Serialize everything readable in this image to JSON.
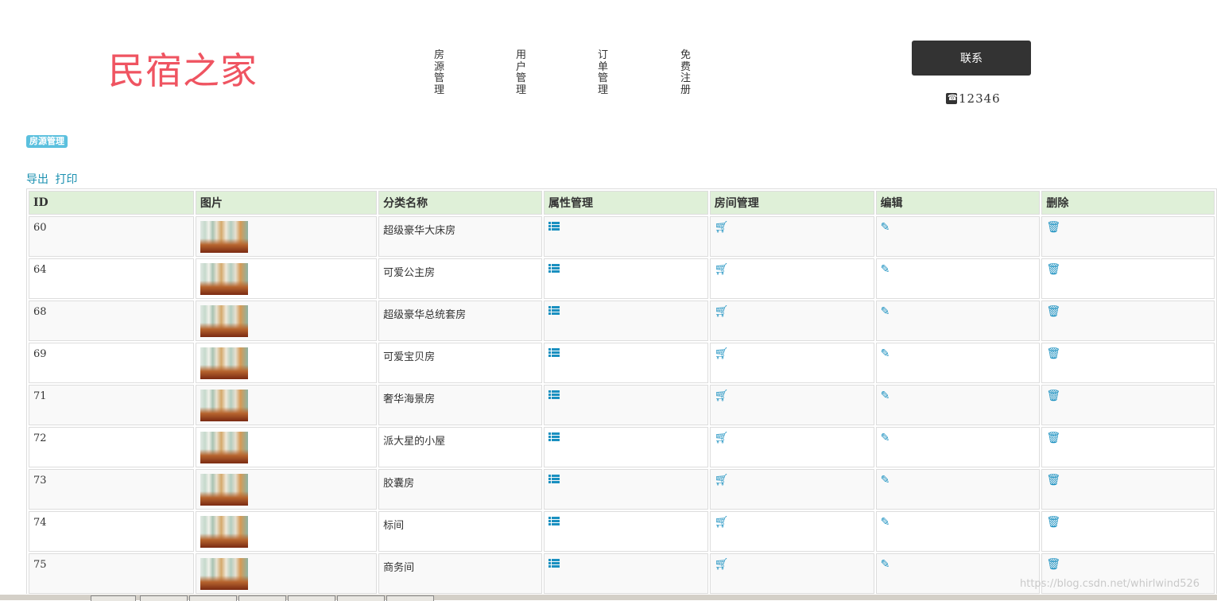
{
  "header": {
    "logo_text": "民宿之家",
    "nav": [
      {
        "label": "房源管理"
      },
      {
        "label": "用户管理"
      },
      {
        "label": "订单管理"
      },
      {
        "label": "免费注册"
      }
    ],
    "contact_label": "联系",
    "phone": "12346"
  },
  "section_badge": "房源管理",
  "toolbar": {
    "export_label": "导出",
    "print_label": "打印"
  },
  "table": {
    "columns": [
      "ID",
      "图片",
      "分类名称",
      "属性管理",
      "房间管理",
      "编辑",
      "删除"
    ],
    "rows": [
      {
        "id": "60",
        "name": "超级豪华大床房"
      },
      {
        "id": "64",
        "name": "可爱公主房"
      },
      {
        "id": "68",
        "name": "超级豪华总统套房"
      },
      {
        "id": "69",
        "name": "可爱宝贝房"
      },
      {
        "id": "71",
        "name": "奢华海景房"
      },
      {
        "id": "72",
        "name": "派大星的小屋"
      },
      {
        "id": "73",
        "name": "胶囊房"
      },
      {
        "id": "74",
        "name": "标间"
      },
      {
        "id": "75",
        "name": "商务间"
      }
    ]
  },
  "icons": {
    "attr": "list-icon",
    "room": "cart-icon",
    "edit": "edit-icon",
    "delete": "trash-icon"
  },
  "colors": {
    "accent": "#1a90c0",
    "logo": "#ef5461",
    "header_bg": "#dff0d8",
    "badge": "#5bc0de"
  },
  "watermark": "https://blog.csdn.net/whirlwind526"
}
